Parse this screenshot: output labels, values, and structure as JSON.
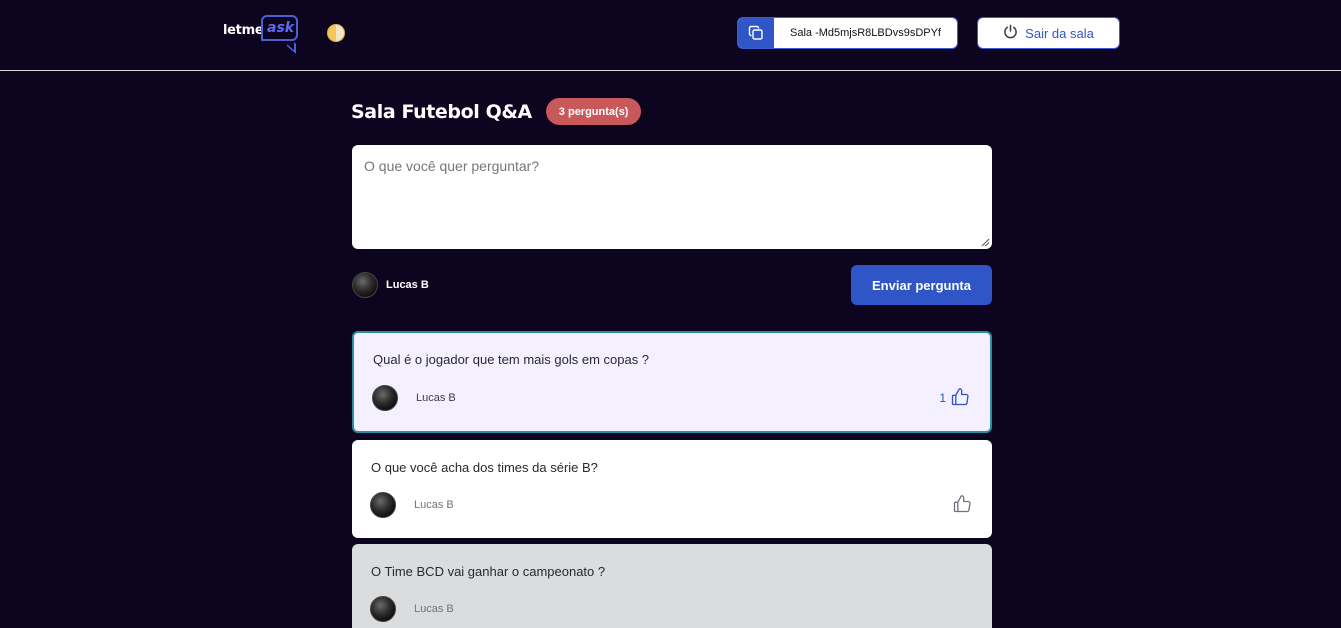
{
  "header": {
    "logo_text": "letme",
    "logo_accent": "ask",
    "room_code": "Sala -Md5mjsR8LBDvs9sDPYf",
    "leave_label": "Sair da sala",
    "icons": [
      "copy-icon",
      "power-icon",
      "theme-toggle-icon"
    ]
  },
  "room": {
    "title": "Sala Futebol Q&A",
    "badge": "3 pergunta(s)"
  },
  "form": {
    "placeholder": "O que você quer perguntar?",
    "author_name": "Lucas B",
    "submit_label": "Enviar pergunta"
  },
  "questions": [
    {
      "text": "Qual é o jogador que tem mais gols em copas ?",
      "author": "Lucas B",
      "likes": "1",
      "state": "highlighted"
    },
    {
      "text": "O que você acha dos times da série B?",
      "author": "Lucas B",
      "likes": "",
      "state": "normal"
    },
    {
      "text": "O Time BCD vai ganhar o campeonato ?",
      "author": "Lucas B",
      "likes": "",
      "state": "answered"
    }
  ],
  "colors": {
    "background": "#0d0520",
    "primary": "#2f55c6",
    "badge": "#c9585b",
    "highlight_border": "#2a8fa3",
    "highlight_bg": "#f4f0ff",
    "answered_bg": "#dbdcdd"
  }
}
